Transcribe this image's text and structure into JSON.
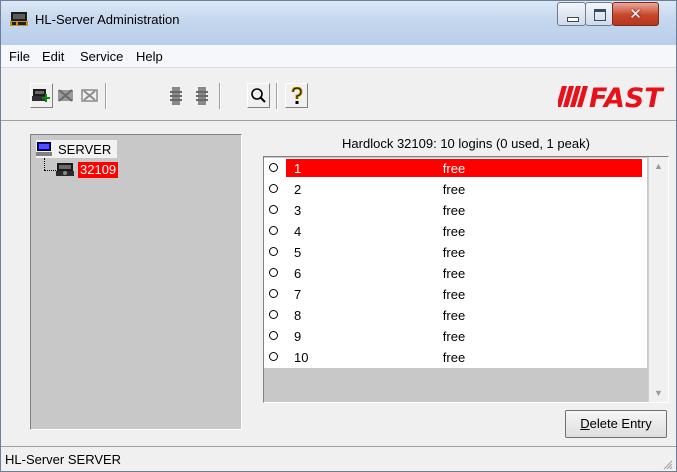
{
  "window": {
    "title": "HL-Server Administration"
  },
  "menu": [
    "File",
    "Edit",
    "Service",
    "Help"
  ],
  "toolbar": {
    "brand": "FAST",
    "buttons": [
      "add-server",
      "remove",
      "delete",
      "connect",
      "disconnect",
      "search",
      "help"
    ]
  },
  "tree": {
    "root_label": "SERVER",
    "child_label": "32109"
  },
  "list": {
    "header": "Hardlock 32109: 10 logins (0 used, 1 peak)",
    "rows": [
      {
        "num": "1",
        "status": "free",
        "selected": true
      },
      {
        "num": "2",
        "status": "free"
      },
      {
        "num": "3",
        "status": "free"
      },
      {
        "num": "4",
        "status": "free"
      },
      {
        "num": "5",
        "status": "free"
      },
      {
        "num": "6",
        "status": "free"
      },
      {
        "num": "7",
        "status": "free"
      },
      {
        "num": "8",
        "status": "free"
      },
      {
        "num": "9",
        "status": "free"
      },
      {
        "num": "10",
        "status": "free"
      }
    ]
  },
  "buttons": {
    "delete_entry": "Delete Entry"
  },
  "status": {
    "text": "HL-Server SERVER"
  },
  "colors": {
    "selection": "#ff0000",
    "brand": "#e8111a"
  }
}
